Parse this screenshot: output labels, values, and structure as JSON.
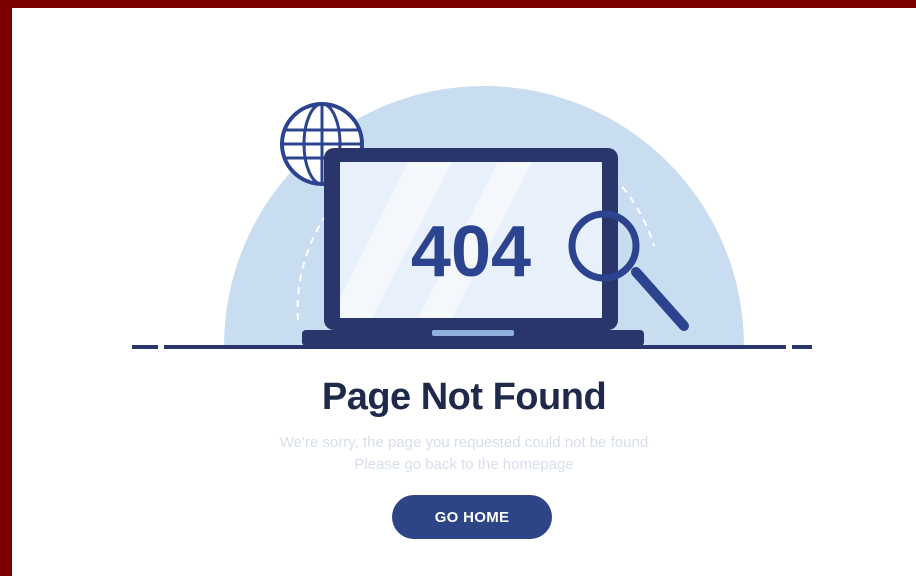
{
  "illustration": {
    "screen_text": "404",
    "icons": [
      "globe-icon",
      "laptop-icon",
      "magnifier-icon"
    ],
    "colors": {
      "circle": "#c9ddf1",
      "laptop": "#2a356b",
      "screen": "#e8f1fb",
      "magnifier": "#2c448f"
    }
  },
  "content": {
    "title": "Page Not Found",
    "message_line1": "We're sorry, the page you requested could not be found",
    "message_line2": "Please go back to the homepage",
    "button_label": "GO HOME"
  },
  "colors": {
    "background_frame": "#7a0000",
    "title": "#1f2a4a",
    "button": "#2d4487",
    "subtitle": "#d7deea"
  }
}
